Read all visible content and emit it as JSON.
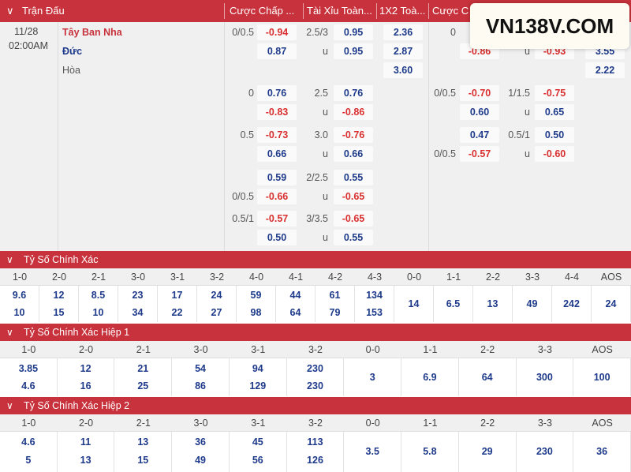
{
  "header": {
    "match": "Trận Đấu",
    "handicap": "Cược Chấp ...",
    "overunder": "Tài Xỉu Toàn...",
    "x12": "1X2 Toà...",
    "handicap_half": "Cược C"
  },
  "logo_text": "VN138V.COM",
  "match": {
    "date": "11/28",
    "time": "02:00AM",
    "team_home": "Tây Ban Nha",
    "team_away": "Đức",
    "draw": "Hòa"
  },
  "odds": {
    "g1": {
      "hcp": "0/0.5",
      "h1": "-0.94",
      "h2": "0.87",
      "ou": "2.5/3",
      "o1": "0.95",
      "u": "u",
      "o2": "0.95"
    },
    "x12": [
      "2.36",
      "2.87",
      "3.60"
    ],
    "half1": {
      "hcp": "0",
      "h2": "-0.86",
      "u": "u",
      "o2": "-0.93",
      "x2": "3.55",
      "x3": "2.22"
    },
    "g2": {
      "hcp": "0",
      "h1": "0.76",
      "h2": "-0.83",
      "ou": "2.5",
      "o1": "0.76",
      "u": "u",
      "o2": "-0.86"
    },
    "g3": {
      "hcp": "0.5",
      "h1": "-0.73",
      "h2": "0.66",
      "ou": "3.0",
      "o1": "-0.76",
      "u": "u",
      "o2": "0.66"
    },
    "g4": {
      "h1": "0.59",
      "hcp2": "0/0.5",
      "h2": "-0.66",
      "ou": "2/2.5",
      "o1": "0.55",
      "u": "u",
      "o2": "-0.65"
    },
    "g5": {
      "hcp": "0.5/1",
      "h1": "-0.57",
      "h2": "0.50",
      "ou": "3/3.5",
      "o1": "-0.65",
      "u": "u",
      "o2": "0.55"
    },
    "half2": {
      "hcp": "0/0.5",
      "h1": "-0.70",
      "h2": "0.60",
      "ou": "1/1.5",
      "o1": "-0.75",
      "u": "u",
      "o2": "0.65"
    },
    "half3": {
      "h1": "0.47",
      "hcp2": "0/0.5",
      "h2": "-0.57",
      "ou": "0.5/1",
      "o1": "0.50",
      "u": "u",
      "o2": "-0.60"
    }
  },
  "sections": {
    "s1": {
      "title": "Tỷ Số Chính Xác",
      "cols": [
        "1-0",
        "2-0",
        "2-1",
        "3-0",
        "3-1",
        "3-2",
        "4-0",
        "4-1",
        "4-2",
        "4-3",
        "0-0",
        "1-1",
        "2-2",
        "3-3",
        "4-4",
        "AOS"
      ],
      "top": [
        "9.6",
        "12",
        "8.5",
        "23",
        "17",
        "24",
        "59",
        "44",
        "61",
        "134"
      ],
      "bottom": [
        "10",
        "15",
        "10",
        "34",
        "22",
        "27",
        "98",
        "64",
        "79",
        "153"
      ],
      "single": [
        "14",
        "6.5",
        "13",
        "49",
        "242",
        "24"
      ]
    },
    "s2": {
      "title": "Tỷ Số Chính Xác Hiệp 1",
      "cols": [
        "1-0",
        "2-0",
        "2-1",
        "3-0",
        "3-1",
        "3-2",
        "0-0",
        "1-1",
        "2-2",
        "3-3",
        "AOS"
      ],
      "top": [
        "3.85",
        "12",
        "21",
        "54",
        "94",
        "230"
      ],
      "bottom": [
        "4.6",
        "16",
        "25",
        "86",
        "129",
        "230"
      ],
      "single": [
        "3",
        "6.9",
        "64",
        "300",
        "100"
      ]
    },
    "s3": {
      "title": "Tỷ Số Chính Xác Hiệp 2",
      "cols": [
        "1-0",
        "2-0",
        "2-1",
        "3-0",
        "3-1",
        "3-2",
        "0-0",
        "1-1",
        "2-2",
        "3-3",
        "AOS"
      ],
      "top": [
        "4.6",
        "11",
        "13",
        "36",
        "45",
        "113"
      ],
      "bottom": [
        "5",
        "13",
        "15",
        "49",
        "56",
        "126"
      ],
      "single": [
        "3.5",
        "5.8",
        "29",
        "230",
        "36"
      ]
    }
  }
}
